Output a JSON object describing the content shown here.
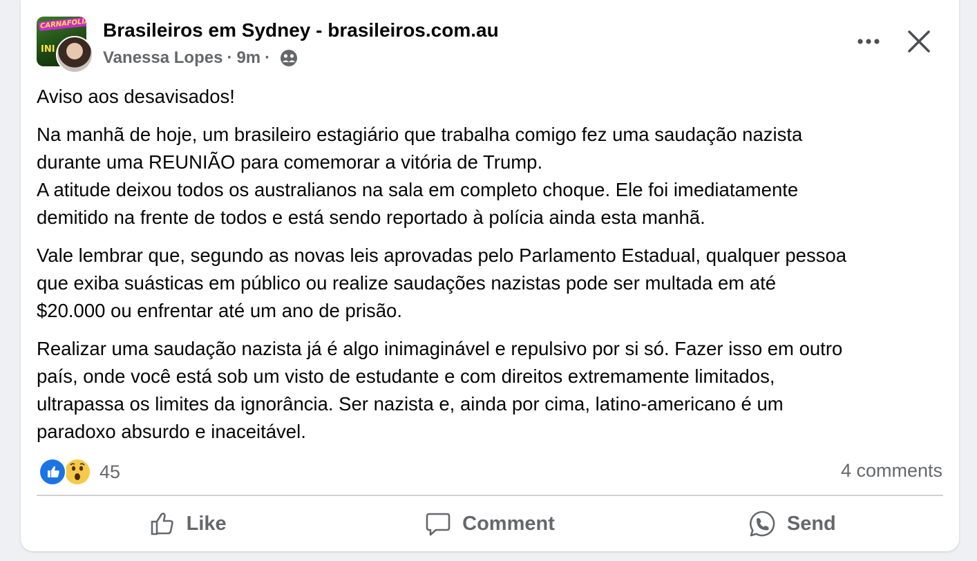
{
  "post": {
    "group_name": "Brasileiros em Sydney - brasileiros.com.au",
    "author": "Vanessa Lopes",
    "separator": "·",
    "time": "9m",
    "group_avatar_text": "CARNAFOLIA",
    "group_avatar_text2": "INI",
    "paragraphs": [
      [
        "Aviso aos desavisados!"
      ],
      [
        "Na manhã de hoje, um brasileiro estagiário que trabalha comigo fez uma saudação nazista",
        "durante uma REUNIÃO para comemorar a vitória de Trump.",
        "A atitude deixou todos os australianos na sala em completo choque. Ele foi imediatamente",
        "demitido na frente de todos e está sendo reportado à polícia ainda esta manhã."
      ],
      [
        "Vale lembrar que, segundo as novas leis aprovadas pelo Parlamento Estadual, qualquer pessoa",
        "que exiba suásticas em público ou realize saudações nazistas pode ser multada em até",
        "$20.000 ou enfrentar até um ano de prisão."
      ],
      [
        "Realizar uma saudação nazista já é algo inimaginável e repulsivo por si só. Fazer isso em outro",
        "país, onde você está sob um visto de estudante e com direitos extremamente limitados,",
        "ultrapassa os limites da ignorância. Ser nazista e, ainda por cima, latino-americano é um",
        "paradoxo absurdo e inaceitável."
      ]
    ],
    "reaction_count": "45",
    "comments_count": "4 comments",
    "reactions": [
      "like-icon",
      "wow-icon"
    ],
    "privacy_icon": "group-members-icon"
  },
  "actions": {
    "like_label": "Like",
    "comment_label": "Comment",
    "send_label": "Send"
  },
  "colors": {
    "like_blue": "#1b74e4",
    "wow_yellow": "#f7c948",
    "secondary_text": "#65676b",
    "divider": "#ced0d4"
  }
}
